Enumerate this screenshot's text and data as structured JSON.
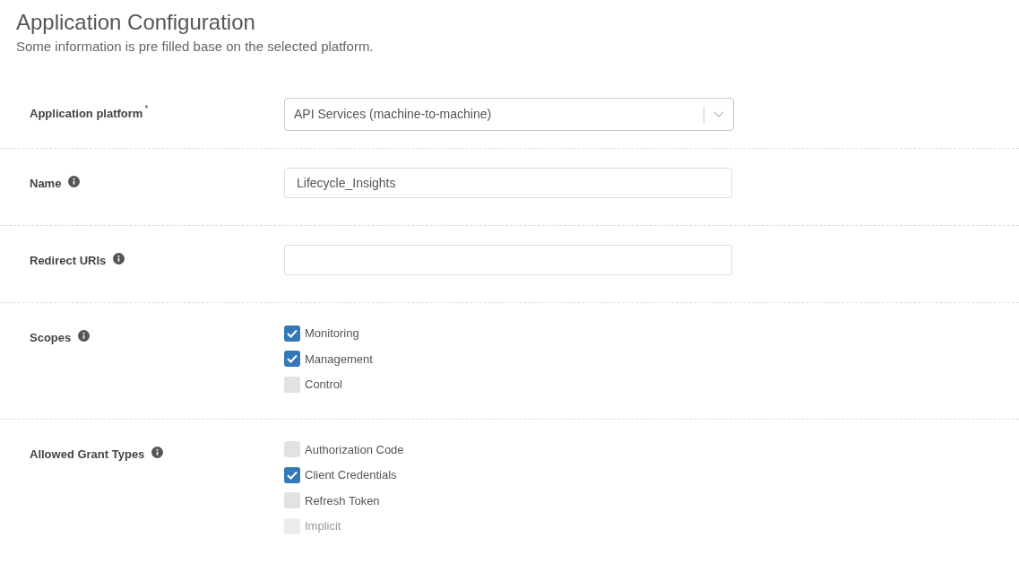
{
  "header": {
    "title": "Application Configuration",
    "subtitle": "Some information is pre filled base on the selected platform."
  },
  "rows": [
    {
      "kind": "select",
      "label": "Application platform",
      "required_mark": "*",
      "info": false,
      "value": "API Services (machine-to-machine)"
    },
    {
      "kind": "text",
      "label": "Name",
      "info": true,
      "value": "Lifecycle_Insights"
    },
    {
      "kind": "text",
      "label": "Redirect URIs",
      "info": true,
      "value": ""
    },
    {
      "kind": "checkboxes",
      "label": "Scopes",
      "info": true,
      "options": [
        {
          "label": "Monitoring",
          "checked": true,
          "disabled": false
        },
        {
          "label": "Management",
          "checked": true,
          "disabled": false
        },
        {
          "label": "Control",
          "checked": false,
          "disabled": false
        }
      ]
    },
    {
      "kind": "checkboxes",
      "label": "Allowed Grant Types",
      "info": true,
      "options": [
        {
          "label": "Authorization Code",
          "checked": false,
          "disabled": false
        },
        {
          "label": "Client Credentials",
          "checked": true,
          "disabled": false
        },
        {
          "label": "Refresh Token",
          "checked": false,
          "disabled": false
        },
        {
          "label": "Implicit",
          "checked": false,
          "disabled": true
        }
      ]
    }
  ]
}
